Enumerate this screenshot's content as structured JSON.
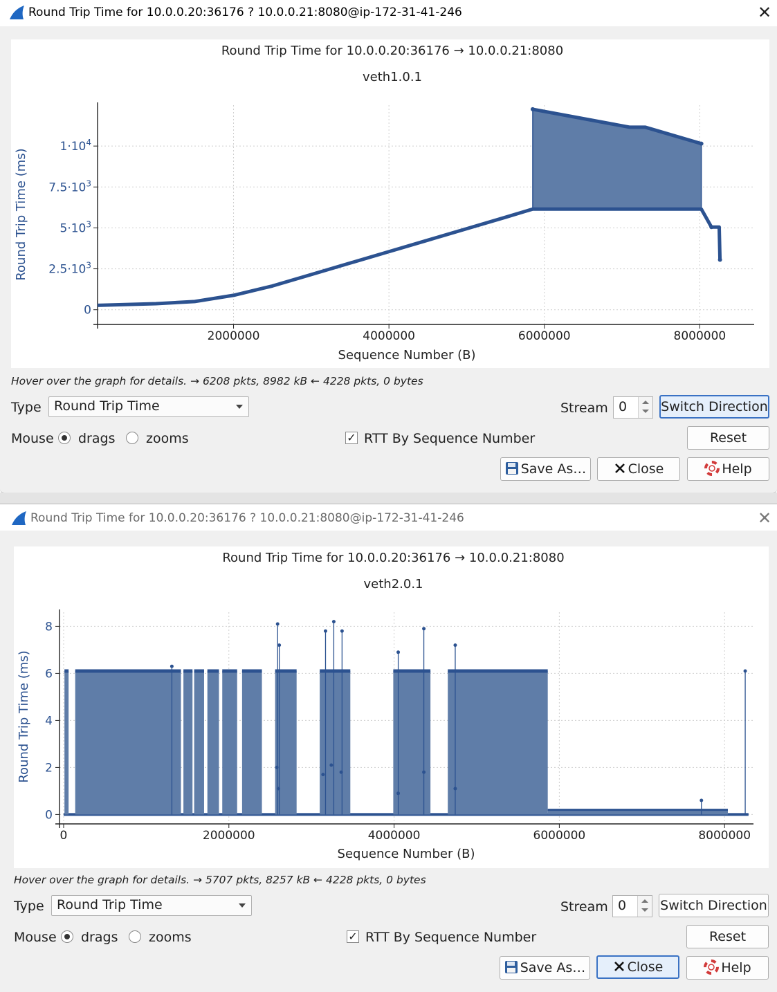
{
  "windows": [
    {
      "id": "w1",
      "title": "Round Trip Time for 10.0.0.20:36176 ? 10.0.0.21:8080@ip-172-31-41-246",
      "plot_title": "Round Trip Time for 10.0.0.20:36176 → 10.0.0.21:8080",
      "plot_subtitle": "veth1.0.1",
      "hover_info": "Hover over the graph for details. → 6208 pkts, 8982 kB ← 4228 pkts, 0 bytes",
      "type_label": "Type",
      "type_value": "Round Trip Time",
      "stream_label": "Stream",
      "stream_value": "0",
      "switch_direction": "Switch Direction",
      "mouse_label": "Mouse",
      "drags_label": "drags",
      "zooms_label": "zooms",
      "rtt_by_seq_label": "RTT By Sequence Number",
      "rtt_by_seq_checked": true,
      "reset_label": "Reset",
      "save_as_label": "Save As…",
      "close_label": "Close",
      "help_label": "Help"
    },
    {
      "id": "w2",
      "title": "Round Trip Time for 10.0.0.20:36176 ? 10.0.0.21:8080@ip-172-31-41-246",
      "plot_title": "Round Trip Time for 10.0.0.20:36176 → 10.0.0.21:8080",
      "plot_subtitle": "veth2.0.1",
      "hover_info": "Hover over the graph for details. → 5707 pkts, 8257 kB ← 4228 pkts, 0 bytes",
      "type_label": "Type",
      "type_value": "Round Trip Time",
      "stream_label": "Stream",
      "stream_value": "0",
      "switch_direction": "Switch Direction",
      "mouse_label": "Mouse",
      "drags_label": "drags",
      "zooms_label": "zooms",
      "rtt_by_seq_label": "RTT By Sequence Number",
      "rtt_by_seq_checked": true,
      "reset_label": "Reset",
      "save_as_label": "Save As…",
      "close_label": "Close",
      "help_label": "Help"
    }
  ],
  "colors": {
    "series": "#2c5290",
    "fill": "#5f7da8",
    "accent_focus": "#3a72c4"
  },
  "icons": {
    "app": "wireshark-fin-icon",
    "close": "close-icon",
    "save": "floppy-disk-icon",
    "close_button": "x-icon",
    "help": "lifebuoy-icon"
  },
  "chart_data": [
    {
      "type": "area",
      "title": "Round Trip Time for 10.0.0.20:36176 → 10.0.0.21:8080",
      "subtitle": "veth1.0.1",
      "xlabel": "Sequence Number (B)",
      "ylabel": "Round Trip Time (ms)",
      "xlim": [
        250000,
        8700000
      ],
      "ylim": [
        -900,
        12500
      ],
      "xticks": [
        2000000,
        4000000,
        6000000,
        8000000
      ],
      "xtick_labels": [
        "2000000",
        "4000000",
        "6000000",
        "8000000"
      ],
      "yticks": [
        0,
        2500,
        5000,
        7500,
        10000
      ],
      "ytick_labels": [
        {
          "base": "0",
          "exp": ""
        },
        {
          "base": "2.5·10",
          "exp": "3"
        },
        {
          "base": "5·10",
          "exp": "3"
        },
        {
          "base": "7.5·10",
          "exp": "3"
        },
        {
          "base": "1·10",
          "exp": "4"
        }
      ],
      "grid": true,
      "series": [
        {
          "role": "lower",
          "x": [
            250000,
            1000000,
            1500000,
            2000000,
            2500000,
            3000000,
            3500000,
            4000000,
            4500000,
            5000000,
            5500000,
            5850000,
            6500000,
            7000000,
            7500000,
            8020000,
            8150000,
            8250000,
            8260000
          ],
          "y": [
            270,
            370,
            500,
            880,
            1450,
            2150,
            2850,
            3550,
            4250,
            4950,
            5650,
            6150,
            6150,
            6150,
            6150,
            6150,
            5050,
            5050,
            3050
          ]
        },
        {
          "role": "upper",
          "x": [
            5850000,
            7100000,
            7300000,
            8020000
          ],
          "y": [
            12250,
            11150,
            11150,
            10150
          ]
        }
      ]
    },
    {
      "type": "scatter",
      "title": "Round Trip Time for 10.0.0.20:36176 → 10.0.0.21:8080",
      "subtitle": "veth2.0.1",
      "xlabel": "Sequence Number (B)",
      "ylabel": "Round Trip Time (ms)",
      "xlim": [
        -50000,
        8350000
      ],
      "ylim": [
        -0.4,
        8.6
      ],
      "xticks": [
        0,
        2000000,
        4000000,
        6000000,
        8000000
      ],
      "xtick_labels": [
        "0",
        "2000000",
        "4000000",
        "6000000",
        "8000000"
      ],
      "yticks": [
        0,
        2,
        4,
        6,
        8
      ],
      "ytick_labels": [
        "0",
        "2",
        "4",
        "6",
        "8"
      ],
      "grid": true,
      "bands": [
        {
          "x0": 10000,
          "x1": 60000,
          "y": 6.1
        },
        {
          "x0": 140000,
          "x1": 1420000,
          "y": 6.1
        },
        {
          "x0": 1450000,
          "x1": 1560000,
          "y": 6.1
        },
        {
          "x0": 1580000,
          "x1": 1700000,
          "y": 6.1
        },
        {
          "x0": 1740000,
          "x1": 1880000,
          "y": 6.1
        },
        {
          "x0": 1920000,
          "x1": 2100000,
          "y": 6.1
        },
        {
          "x0": 2160000,
          "x1": 2400000,
          "y": 6.1
        },
        {
          "x0": 2560000,
          "x1": 2820000,
          "y": 6.1
        },
        {
          "x0": 3100000,
          "x1": 3470000,
          "y": 6.1
        },
        {
          "x0": 3990000,
          "x1": 4440000,
          "y": 6.1
        },
        {
          "x0": 4650000,
          "x1": 5860000,
          "y": 6.1
        }
      ],
      "low_band": {
        "x0": 5860000,
        "x1": 8040000,
        "y": 0.2
      },
      "spikes": [
        {
          "x": 1310000,
          "y": 6.3
        },
        {
          "x": 2590000,
          "y": 8.1
        },
        {
          "x": 2610000,
          "y": 7.2
        },
        {
          "x": 3170000,
          "y": 7.8
        },
        {
          "x": 3270000,
          "y": 8.2
        },
        {
          "x": 3370000,
          "y": 7.8
        },
        {
          "x": 4050000,
          "y": 6.9
        },
        {
          "x": 4360000,
          "y": 7.9
        },
        {
          "x": 4740000,
          "y": 7.2
        },
        {
          "x": 7720000,
          "y": 0.6
        },
        {
          "x": 8250000,
          "y": 6.1
        }
      ],
      "outliers": [
        {
          "x": 2580000,
          "y": 2.0
        },
        {
          "x": 2600000,
          "y": 1.1
        },
        {
          "x": 3140000,
          "y": 1.7
        },
        {
          "x": 3240000,
          "y": 2.1
        },
        {
          "x": 3360000,
          "y": 1.8
        },
        {
          "x": 4050000,
          "y": 0.9
        },
        {
          "x": 4360000,
          "y": 1.8
        },
        {
          "x": 4740000,
          "y": 1.1
        }
      ]
    }
  ]
}
